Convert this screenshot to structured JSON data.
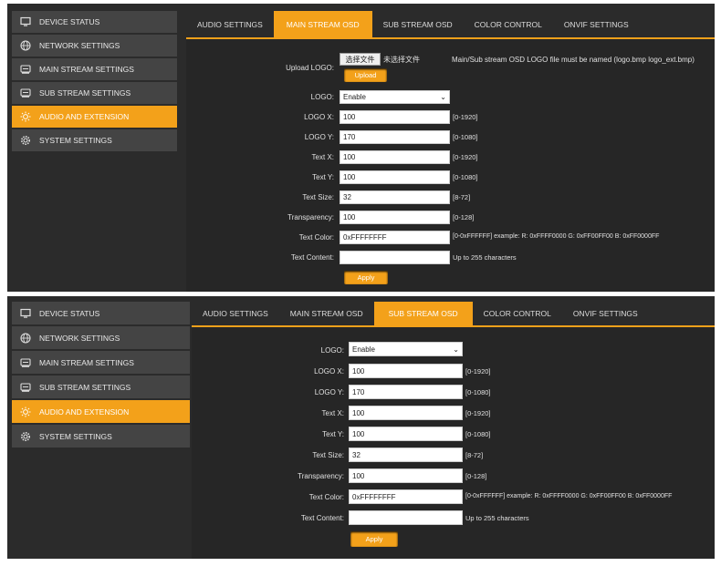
{
  "colors": {
    "accent": "#f3a11a",
    "panel_bg": "#2b2b2b",
    "sidebar_item_bg": "#444444"
  },
  "sidebar": {
    "items": [
      {
        "label": "DEVICE STATUS",
        "icon": "monitor-icon"
      },
      {
        "label": "NETWORK SETTINGS",
        "icon": "globe-icon"
      },
      {
        "label": "MAIN STREAM SETTINGS",
        "icon": "stream-icon"
      },
      {
        "label": "SUB STREAM SETTINGS",
        "icon": "stream-icon"
      },
      {
        "label": "AUDIO AND EXTENSION",
        "icon": "sun-icon",
        "active": true
      },
      {
        "label": "SYSTEM SETTINGS",
        "icon": "gear-icon"
      }
    ]
  },
  "tabs": [
    "AUDIO SETTINGS",
    "MAIN STREAM OSD",
    "SUB STREAM OSD",
    "COLOR CONTROL",
    "ONVIF SETTINGS"
  ],
  "panel1": {
    "active_tab": "MAIN STREAM OSD",
    "upload_label": "Upload LOGO:",
    "choose_file": "选择文件",
    "no_file": "未选择文件",
    "upload_note": "Main/Sub stream OSD LOGO file must be named (logo.bmp logo_ext.bmp)",
    "upload_button": "Upload",
    "fields": [
      {
        "label": "LOGO:",
        "value": "Enable",
        "hint": ""
      },
      {
        "label": "LOGO X:",
        "value": "100",
        "hint": "[0-1920]"
      },
      {
        "label": "LOGO Y:",
        "value": "170",
        "hint": "[0-1080]"
      },
      {
        "label": "Text X:",
        "value": "100",
        "hint": "[0-1920]"
      },
      {
        "label": "Text Y:",
        "value": "100",
        "hint": "[0-1080]"
      },
      {
        "label": "Text Size:",
        "value": "32",
        "hint": "[8-72]"
      },
      {
        "label": "Transparency:",
        "value": "100",
        "hint": "[0-128]"
      },
      {
        "label": "Text Color:",
        "value": "0xFFFFFFFF",
        "hint": "[0-0xFFFFFF] example: R: 0xFFFF0000 G: 0xFF00FF00 B: 0xFF0000FF"
      },
      {
        "label": "Text Content:",
        "value": "",
        "hint": "Up to 255 characters"
      }
    ],
    "apply": "Apply"
  },
  "panel2": {
    "active_tab": "SUB STREAM OSD",
    "fields": [
      {
        "label": "LOGO:",
        "value": "Enable",
        "hint": ""
      },
      {
        "label": "LOGO X:",
        "value": "100",
        "hint": "[0-1920]"
      },
      {
        "label": "LOGO Y:",
        "value": "170",
        "hint": "[0-1080]"
      },
      {
        "label": "Text X:",
        "value": "100",
        "hint": "[0-1920]"
      },
      {
        "label": "Text Y:",
        "value": "100",
        "hint": "[0-1080]"
      },
      {
        "label": "Text Size:",
        "value": "32",
        "hint": "[8-72]"
      },
      {
        "label": "Transparency:",
        "value": "100",
        "hint": "[0-128]"
      },
      {
        "label": "Text Color:",
        "value": "0xFFFFFFFF",
        "hint": "[0-0xFFFFFF] example: R: 0xFFFF0000 G: 0xFF00FF00 B: 0xFF0000FF"
      },
      {
        "label": "Text Content:",
        "value": "",
        "hint": "Up to 255 characters"
      }
    ],
    "apply": "Apply"
  }
}
